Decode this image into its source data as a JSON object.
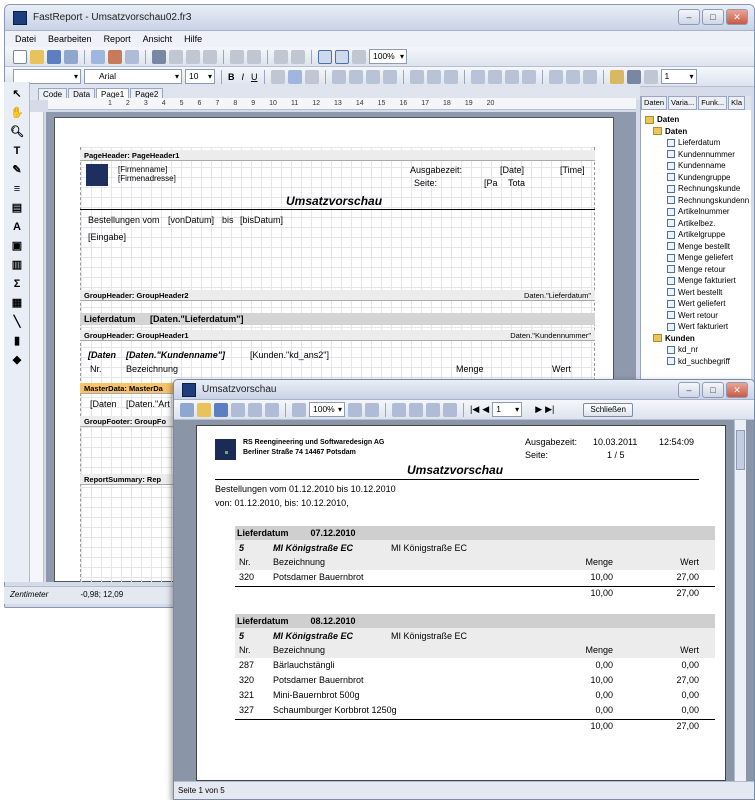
{
  "main_window": {
    "title": "FastReport - Umsatzvorschau02.fr3",
    "menu": [
      "Datei",
      "Bearbeiten",
      "Report",
      "Ansicht",
      "Hilfe"
    ],
    "zoom": "100%",
    "font_name": "Arial",
    "font_size": "10",
    "columns_value": "1",
    "tabs": [
      "Code",
      "Data",
      "Page1",
      "Page2"
    ],
    "ruler": [
      "1",
      "2",
      "3",
      "4",
      "5",
      "6",
      "7",
      "8",
      "9",
      "10",
      "11",
      "12",
      "13",
      "14",
      "15",
      "16",
      "17",
      "18",
      "19",
      "20"
    ],
    "status_unit": "Zentimeter",
    "status_coords": "-0,98; 12,09"
  },
  "right_panel": {
    "tabs": [
      "Daten",
      "Varia...",
      "Funk...",
      "Kla"
    ],
    "root": "Daten",
    "group1": "Daten",
    "group1_fields": [
      "Lieferdatum",
      "Kundennummer",
      "Kundenname",
      "Kundengruppe",
      "Rechnungskunde",
      "Rechnungskundenn",
      "Artikelnummer",
      "Artikelbez.",
      "Artikelgruppe",
      "Menge bestellt",
      "Menge geliefert",
      "Menge retour",
      "Menge fakturiert",
      "Wert bestellt",
      "Wert geliefert",
      "Wert retour",
      "Wert fakturiert"
    ],
    "group2": "Kunden",
    "group2_fields": [
      "kd_nr",
      "kd_suchbegriff"
    ]
  },
  "designer": {
    "page_header_band": "PageHeader: PageHeader1",
    "firmenname": "[Firmenname]",
    "firmenadresse": "[Firmenadresse]",
    "ausgabezeit_label": "Ausgabezeit:",
    "date_field": "[Date]",
    "time_field": "[Time]",
    "seite_label": "Seite:",
    "page_field": "[Pa",
    "total_field": "Tota",
    "title": "Umsatzvorschau",
    "bestellungen_vom": "Bestellungen vom",
    "von_datum": "[vonDatum]",
    "bis": "bis",
    "bis_datum": "[bisDatum]",
    "eingabe": "[Eingabe]",
    "group_header2": "GroupHeader: GroupHeader2",
    "group_header2_right": "Daten.\"Lieferdatum\"",
    "lieferdatum_label": "Lieferdatum",
    "lieferdatum_field": "[Daten.\"Lieferdatum\"]",
    "group_header1": "GroupHeader: GroupHeader1",
    "group_header1_right": "Daten.\"Kundennummer\"",
    "daten_label": "[Daten",
    "kundenname_field": "[Daten.\"Kundenname\"]",
    "kunden_field": "[Kunden.\"kd_ans2\"]",
    "nr_label": "Nr.",
    "bezeichnung_label": "Bezeichnung",
    "menge_label": "Menge",
    "wert_label": "Wert",
    "master_data": "MasterData: MasterDa",
    "md_field1": "[Daten",
    "md_field2": "[Daten.\"Art",
    "group_footer": "GroupFooter: GroupFo",
    "report_summary": "ReportSummary: Rep"
  },
  "preview_window": {
    "title": "Umsatzvorschau",
    "zoom": "100%",
    "page_input": "1",
    "close_button": "Schließen",
    "status": "Seite 1 von 5",
    "company_name": "RS Reengineering und Softwaredesign AG",
    "company_address": "Berliner Straße 74 14467 Potsdam",
    "ausgabezeit_label": "Ausgabezeit:",
    "date": "10.03.2011",
    "time": "12:54:09",
    "seite_label": "Seite:",
    "page_of": "1 / 5",
    "line1": "Bestellungen vom  01.12.2010  bis  10.12.2010",
    "line2": "von: 01.12.2010, bis: 10.12.2010,",
    "groups": [
      {
        "lieferdatum_label": "Lieferdatum",
        "date": "07.12.2010",
        "kundennr": "5",
        "kundenname": "MI Königstraße EC",
        "kundenname2": "MI Königstraße EC",
        "hdr_nr": "Nr.",
        "hdr_bez": "Bezeichnung",
        "hdr_menge": "Menge",
        "hdr_wert": "Wert",
        "rows": [
          {
            "nr": "320",
            "bez": "Potsdamer Bauernbrot",
            "menge": "10,00",
            "wert": "27,00"
          }
        ],
        "total_menge": "10,00",
        "total_wert": "27,00"
      },
      {
        "lieferdatum_label": "Lieferdatum",
        "date": "08.12.2010",
        "kundennr": "5",
        "kundenname": "MI Königstraße EC",
        "kundenname2": "MI Königstraße EC",
        "hdr_nr": "Nr.",
        "hdr_bez": "Bezeichnung",
        "hdr_menge": "Menge",
        "hdr_wert": "Wert",
        "rows": [
          {
            "nr": "287",
            "bez": "Bärlauchstängli",
            "menge": "0,00",
            "wert": "0,00"
          },
          {
            "nr": "320",
            "bez": "Potsdamer Bauernbrot",
            "menge": "10,00",
            "wert": "27,00"
          },
          {
            "nr": "321",
            "bez": "Mini-Bauernbrot 500g",
            "menge": "0,00",
            "wert": "0,00"
          },
          {
            "nr": "327",
            "bez": "Schaumburger Korbbrot 1250g",
            "menge": "0,00",
            "wert": "0,00"
          }
        ],
        "total_menge": "10,00",
        "total_wert": "27,00"
      }
    ]
  }
}
